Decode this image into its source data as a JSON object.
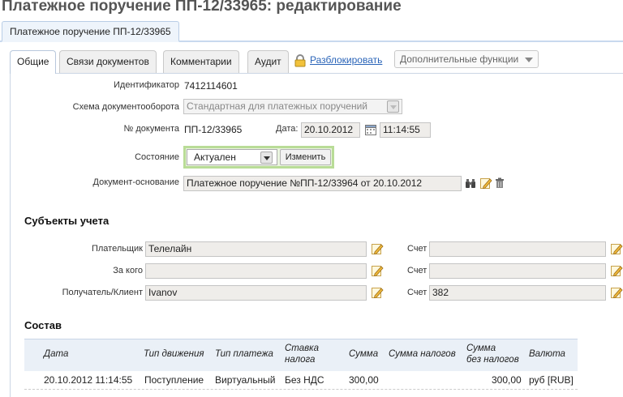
{
  "page": {
    "title": "Платежное поручение ПП-12/33965: редактирование"
  },
  "doc_tab": {
    "label": "Платежное поручение ПП-12/33965"
  },
  "tabs": [
    {
      "label": "Общие",
      "active": true
    },
    {
      "label": "Связи документов",
      "active": false
    },
    {
      "label": "Комментарии",
      "active": false
    },
    {
      "label": "Аудит",
      "active": false
    }
  ],
  "toolbar": {
    "unlock_label": "Разблокировать",
    "more_label": "Дополнительные функции"
  },
  "form": {
    "id_label": "Идентификатор",
    "id_value": "7412114601",
    "scheme_label": "Схема документооборота",
    "scheme_value": "Стандартная для платежных поручений",
    "docnum_label": "№ документа",
    "docnum_value": "ПП-12/33965",
    "date_label": "Дата:",
    "date_value": "20.10.2012",
    "time_value": "11:14:55",
    "state_label": "Состояние",
    "state_value": "Актуален",
    "change_label": "Изменить",
    "basis_label": "Документ-основание",
    "basis_value": "Платежное поручение №ПП-12/33964 от 20.10.2012"
  },
  "subjects": {
    "title": "Субъекты учета",
    "payer_label": "Плательщик",
    "payer_value": "Телелайн",
    "for_label": "За кого",
    "for_value": "",
    "recipient_label": "Получатель/Клиент",
    "recipient_value": "Ivanov",
    "account_label": "Счет",
    "account1_value": "",
    "account2_value": "",
    "account3_value": "382"
  },
  "composition": {
    "title": "Состав",
    "headers": {
      "date": "Дата",
      "move_type": "Тип движения",
      "payment_type": "Тип платежа",
      "tax_rate_1": "Ставка",
      "tax_rate_2": "налога",
      "amount": "Сумма",
      "tax_amount": "Сумма налогов",
      "net_1": "Сумма",
      "net_2": "без налогов",
      "currency": "Валюта"
    },
    "rows": [
      {
        "date": "20.10.2012 11:14:55",
        "move_type": "Поступление",
        "payment_type": "Виртуальный",
        "tax_rate": "Без НДС",
        "amount": "300,00",
        "tax_amount": "",
        "net": "300,00",
        "currency": "руб [RUB]"
      }
    ]
  },
  "colors": {
    "accent_link": "#2a64b8",
    "state_highlight": "#b9dc97",
    "tab_blue": "#eef4fb"
  }
}
